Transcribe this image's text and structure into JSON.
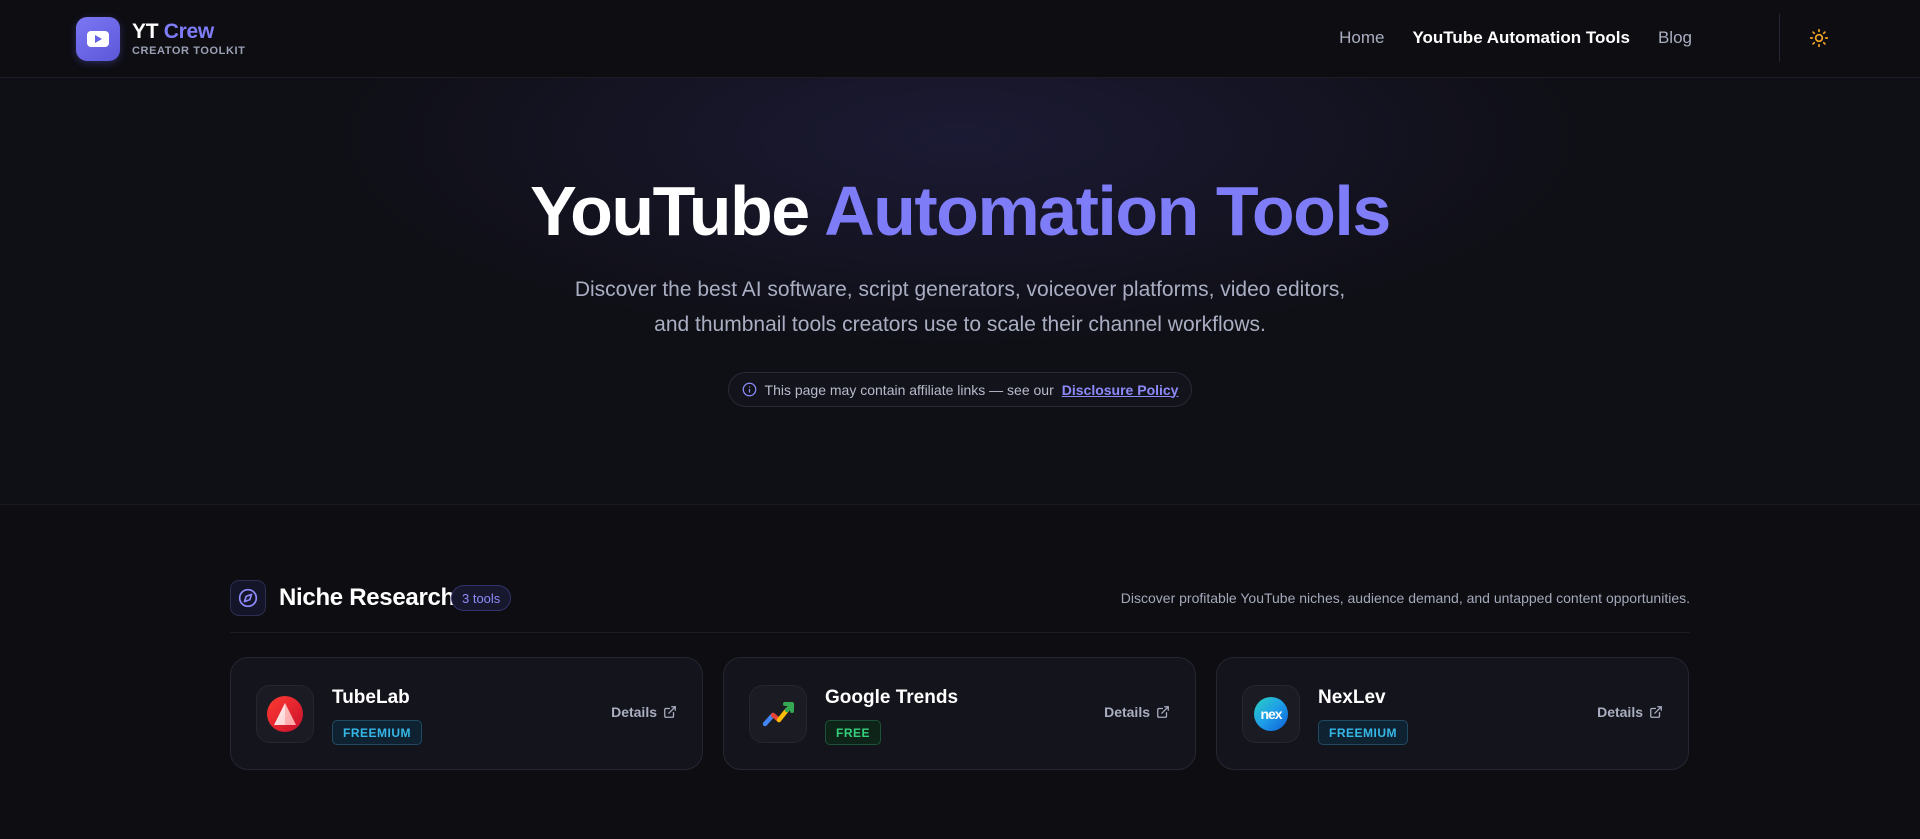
{
  "header": {
    "brand_prefix": "YT",
    "brand_accent": "Crew",
    "brand_subtitle": "CREATOR TOOLKIT",
    "nav": [
      {
        "label": "Home"
      },
      {
        "label": "YouTube Automation Tools"
      },
      {
        "label": "Blog"
      }
    ],
    "active_nav": "YouTube Automation Tools",
    "theme_icon": "sun-icon"
  },
  "hero": {
    "title_plain": "YouTube",
    "title_accent": "Automation Tools",
    "description_line1": "Discover the best AI software, script generators, voiceover platforms, video editors,",
    "description_line2": "and thumbnail tools creators use to scale their channel workflows.",
    "notice_text": "This page may contain affiliate links — see our",
    "notice_link": "Disclosure Policy"
  },
  "section": {
    "title": "Niche Research",
    "count": "3 tools",
    "description": "Discover profitable YouTube niches, audience demand, and untapped content opportunities.",
    "icon": "compass-icon"
  },
  "tools": [
    {
      "name": "TubeLab",
      "badge": "FREEMIUM",
      "details": "Details",
      "logo": "tubelab-logo"
    },
    {
      "name": "Google Trends",
      "badge": "FREE",
      "details": "Details",
      "logo": "google-trends-logo"
    },
    {
      "name": "NexLev",
      "badge": "FREEMIUM",
      "details": "Details",
      "logo": "nexlev-logo",
      "logo_text": "nex"
    }
  ],
  "colors": {
    "background": "#0d0d12",
    "accent": "#7f7cf8",
    "badge_freemium": "#35b8e8",
    "badge_free": "#34d27a",
    "sun_icon": "#f5a524"
  }
}
